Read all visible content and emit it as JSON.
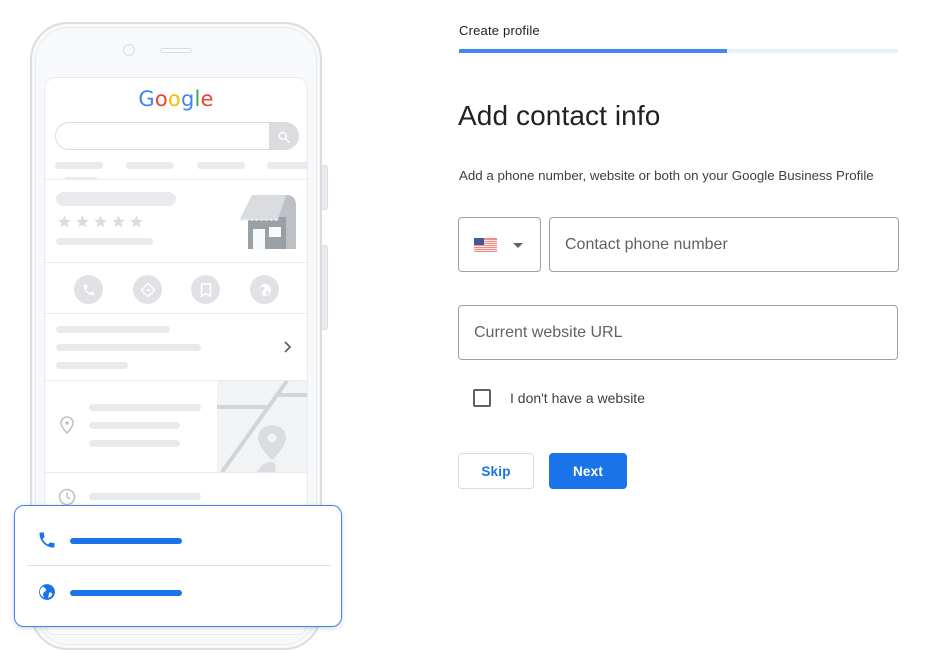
{
  "header": {
    "step_label": "Create profile",
    "progress_percent": 61
  },
  "form": {
    "title": "Add contact info",
    "subtitle": "Add a phone number, website or both on your Google Business Profile",
    "country": {
      "selected": "United States",
      "flag_icon": "us-flag-icon"
    },
    "phone_field": {
      "value": "",
      "placeholder": "Contact phone number"
    },
    "website_field": {
      "value": "",
      "placeholder": "Current website URL"
    },
    "no_website_checkbox": {
      "label": "I don't have a website",
      "checked": false
    },
    "buttons": {
      "skip_label": "Skip",
      "next_label": "Next"
    }
  },
  "illustration": {
    "logo_letters": [
      "G",
      "o",
      "o",
      "g",
      "l",
      "e"
    ],
    "logo_colors": [
      "#4285f4",
      "#ea4335",
      "#fbbc05",
      "#4285f4",
      "#34a853",
      "#ea4335"
    ],
    "rating_stars": 5,
    "action_icons": [
      "phone-icon",
      "directions-icon",
      "bookmark-icon",
      "globe-icon"
    ],
    "contact_card_icons": [
      "phone-icon",
      "globe-icon"
    ]
  },
  "colors": {
    "accent": "#1a73e8",
    "progress_fill": "#4285f4",
    "progress_track": "#e8f0fe",
    "placeholder_gray": "#dadce0"
  }
}
